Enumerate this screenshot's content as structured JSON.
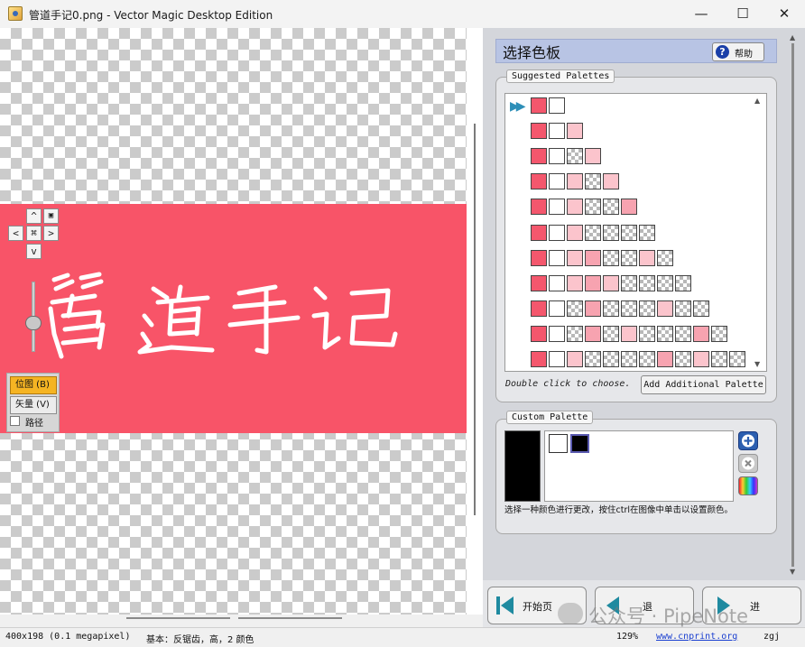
{
  "window": {
    "title": "管道手记0.png - Vector Magic Desktop Edition",
    "minimize": "—",
    "maximize": "☐",
    "close": "✕"
  },
  "canvas": {
    "nav": {
      "up": "^",
      "down": "v",
      "left": "<",
      "right": ">",
      "center": "⌘",
      "fit": "▣"
    },
    "mode": {
      "bitmap": "位图 (B)",
      "vector": "矢量 (V)",
      "path": "路径"
    }
  },
  "panel": {
    "title": "选择色板",
    "help": "帮助",
    "suggested_title": "Suggested Palettes",
    "hint": "Double click to choose.",
    "add_button": "Add Additional Palette",
    "custom_title": "Custom Palette",
    "custom_note": "选择一种颜色进行更改，按住ctrl在图像中单击以设置颜色。",
    "palettes": [
      [
        "r",
        "w"
      ],
      [
        "r",
        "w",
        "l"
      ],
      [
        "r",
        "w",
        "c",
        "l"
      ],
      [
        "r",
        "w",
        "l",
        "c",
        "l"
      ],
      [
        "r",
        "w",
        "l",
        "c",
        "c",
        "m"
      ],
      [
        "r",
        "w",
        "l",
        "c",
        "c",
        "c",
        "c"
      ],
      [
        "r",
        "w",
        "l",
        "m",
        "c",
        "c",
        "l",
        "c"
      ],
      [
        "r",
        "w",
        "l",
        "m",
        "l",
        "c",
        "c",
        "c",
        "c"
      ],
      [
        "r",
        "w",
        "c",
        "m",
        "c",
        "c",
        "c",
        "l",
        "c",
        "c"
      ],
      [
        "r",
        "w",
        "c",
        "m",
        "c",
        "l",
        "c",
        "c",
        "c",
        "m",
        "c"
      ],
      [
        "r",
        "w",
        "l",
        "c",
        "c",
        "c",
        "c",
        "m",
        "c",
        "l",
        "c",
        "c"
      ]
    ],
    "swatch_colors": {
      "r": "#f4576d",
      "w": "#ffffff",
      "l": "#fbc4cc",
      "m": "#f7a3b0"
    },
    "custom_colors": [
      "#ffffff",
      "#000000"
    ]
  },
  "nav": {
    "start": "开始页",
    "back": "退",
    "next": "进"
  },
  "watermark": "公众号 · PipeNote",
  "status": {
    "size": "400x198 (0.1 megapixel)",
    "mode": "基本：反锯齿，高，2 颜色",
    "zoom": "129%",
    "link": "www.cnprint.org",
    "user": "zgj"
  }
}
